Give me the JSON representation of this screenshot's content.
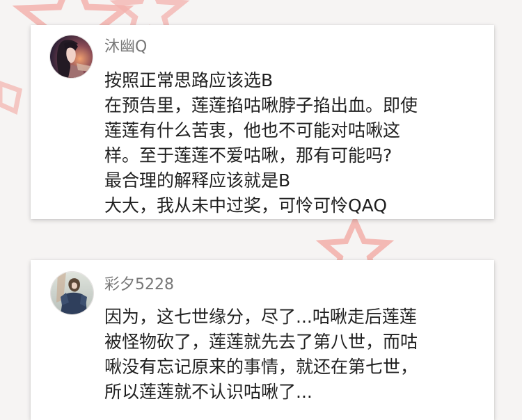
{
  "comments": [
    {
      "username": "沐幽Q",
      "lines": [
        "按照正常思路应该选B",
        "在预告里，莲莲掐咕啾脖子掐出血。即使",
        "莲莲有什么苦衷，他也不可能对咕啾这",
        "样。至于莲莲不爱咕啾，那有可能吗?",
        "最合理的解释应该就是B",
        "大大，我从未中过奖，可怜可怜QAQ"
      ]
    },
    {
      "username": "彩夕5228",
      "lines": [
        "因为，这七世缘分，尽了...咕啾走后莲莲",
        "被怪物砍了，莲莲就先去了第八世，而咕",
        "啾没有忘记原来的事情，就还在第七世，",
        "所以莲莲就不认识咕啾了..."
      ]
    }
  ],
  "colors": {
    "background": "#f6f4f3",
    "decor_star": "#f3b2ad",
    "username": "#777777",
    "comment_text": "#1f1f1f"
  }
}
